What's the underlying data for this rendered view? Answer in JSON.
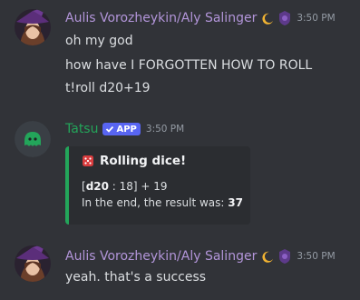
{
  "messages": [
    {
      "author": "Aulis Vorozheykin/Aly Salinger",
      "author_color": "#b295d9",
      "time": "3:50 PM",
      "lines": [
        "oh my god",
        "how have I FORGOTTEN HOW TO ROLL",
        "t!roll d20+19"
      ]
    },
    {
      "author": "Tatsu",
      "author_color": "#23a55a",
      "app_badge": "APP",
      "time": "3:50 PM",
      "embed": {
        "title": "Rolling dice!",
        "roll_open": "[",
        "die": "d20",
        "roll_rest": " : 18] + 19",
        "result_prefix": "In the end, the result was: ",
        "result": "37",
        "accent": "#23a55a"
      }
    },
    {
      "author": "Aulis Vorozheykin/Aly Salinger",
      "author_color": "#b295d9",
      "time": "3:50 PM",
      "lines": [
        "yeah. that's a success"
      ]
    }
  ]
}
